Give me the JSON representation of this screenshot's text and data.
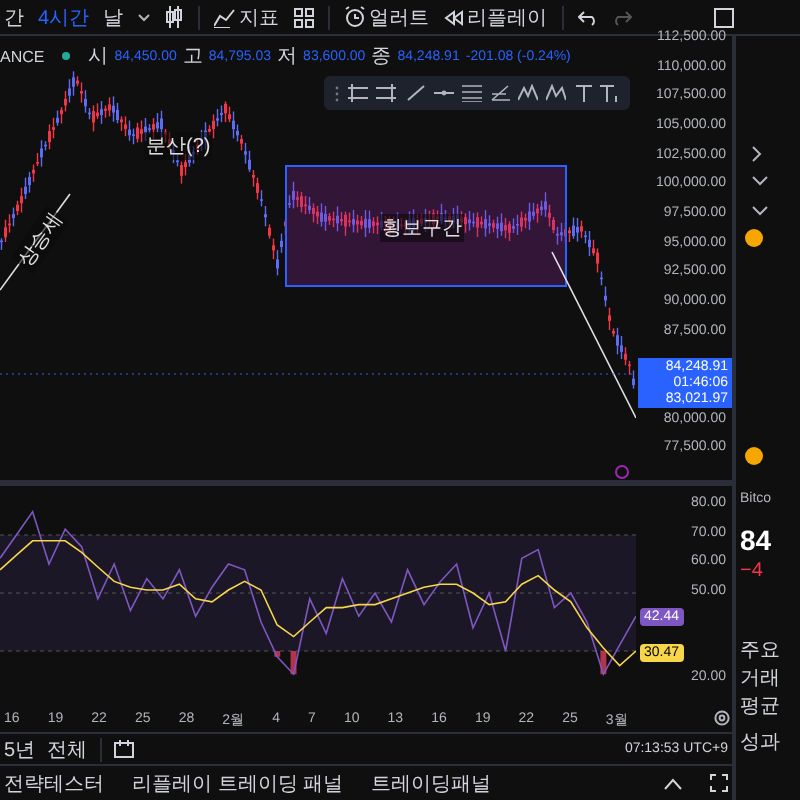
{
  "toolbar": {
    "timeframes": [
      {
        "label": "간",
        "selected": false
      },
      {
        "label": "4시간",
        "selected": true
      },
      {
        "label": "날",
        "selected": false
      }
    ],
    "indicators_label": "지표",
    "alert_label": "얼러트",
    "replay_label": "리플레이"
  },
  "legend": {
    "exchange": "ANCE",
    "ohlc": [
      {
        "label": "시",
        "value": "84,450.00"
      },
      {
        "label": "고",
        "value": "84,795.03"
      },
      {
        "label": "저",
        "value": "83,600.00"
      },
      {
        "label": "종",
        "value": "84,248.91"
      }
    ],
    "change": "-201.08 (-0.24%)"
  },
  "annotations": {
    "uptrend": "상승세",
    "distribution": "분산(?)",
    "range": "횡보구간"
  },
  "price_axis": {
    "labels": [
      "112,500.00",
      "110,000.00",
      "107,500.00",
      "105,000.00",
      "102,500.00",
      "100,000.00",
      "97,500.00",
      "95,000.00",
      "92,500.00",
      "90,000.00",
      "87,500.00",
      "80,000.00",
      "77,500.00"
    ],
    "current_price": "84,248.91",
    "countdown": "01:46:06",
    "secondary_price": "83,021.97"
  },
  "rsi_pane": {
    "chart_data": {
      "type": "line",
      "ylim": [
        20,
        80
      ],
      "yticks": [
        {
          "value": 80,
          "label": "80.00"
        },
        {
          "value": 70,
          "label": "70.00"
        },
        {
          "value": 60,
          "label": "60.00"
        },
        {
          "value": 50,
          "label": "50.00"
        },
        {
          "value": 20,
          "label": "20.00"
        }
      ],
      "series": [
        {
          "color": "#7e57c2",
          "values": [
            62,
            70,
            78,
            60,
            72,
            66,
            48,
            60,
            44,
            55,
            48,
            58,
            42,
            52,
            60,
            58,
            40,
            28,
            22,
            48,
            36,
            55,
            42,
            50,
            40,
            58,
            46,
            54,
            60,
            38,
            50,
            30,
            62,
            65,
            45,
            50,
            40,
            22,
            32,
            42
          ]
        },
        {
          "color": "#f7d64a",
          "values": [
            58,
            63,
            68,
            68,
            68,
            64,
            59,
            54,
            52,
            51,
            51,
            53,
            48,
            47,
            51,
            54,
            51,
            39,
            35,
            40,
            45,
            45,
            46,
            46,
            48,
            50,
            52,
            53,
            53,
            50,
            46,
            47,
            53,
            56,
            51,
            47,
            38,
            31,
            25,
            30
          ]
        }
      ]
    },
    "markers": [
      {
        "value": "42.44",
        "color": "#7e57c2"
      },
      {
        "value": "30.47",
        "color": "#f7d64a"
      }
    ]
  },
  "date_axis": [
    "16",
    "19",
    "22",
    "25",
    "28",
    "2월",
    "4",
    "7",
    "10",
    "13",
    "16",
    "19",
    "22",
    "25",
    "3월"
  ],
  "bottom_bar": {
    "ranges": [
      "5년",
      "전체"
    ],
    "clock": "07:13:53 UTC+9"
  },
  "bottom_tabs": [
    "전략테스터",
    "리플레이 트레이딩 패널",
    "트레이딩패널"
  ],
  "side_panel": [
    {
      "text": "Bitco",
      "kind": "label"
    },
    {
      "text": "84",
      "kind": "price"
    },
    {
      "text": "−4",
      "kind": "change"
    },
    {
      "text": "주요",
      "kind": "section"
    },
    {
      "text": "거래",
      "kind": "section"
    },
    {
      "text": "평균",
      "kind": "section"
    },
    {
      "text": "성과",
      "kind": "section"
    }
  ]
}
